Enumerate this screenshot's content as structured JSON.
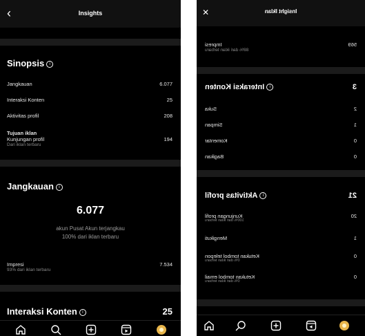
{
  "left": {
    "header": {
      "title": "Insights"
    },
    "sinopsis": {
      "title": "Sinopsis",
      "rows": [
        {
          "label": "Jangkauan",
          "value": "6.077"
        },
        {
          "label": "Interaksi Konten",
          "value": "25"
        },
        {
          "label": "Aktivitas profil",
          "value": "208"
        }
      ],
      "goal_title": "Tujuan iklan",
      "goal_label": "Kunjungan profil",
      "goal_sub": "Dari iklan terbaru",
      "goal_value": "194"
    },
    "jangkauan": {
      "title": "Jangkauan",
      "big_value": "6.077",
      "desc1": "akun Pusat Akun terjangkau",
      "desc2": "100% dari iklan terbaru",
      "impresi_label": "Impresi",
      "impresi_sub": "93% dari iklan terbaru",
      "impresi_value": "7.534"
    },
    "interaksi": {
      "title": "Interaksi Konten",
      "value": "25"
    }
  },
  "right": {
    "header": {
      "title": "Insight Iklan"
    },
    "impresi": {
      "label": "Impresi",
      "sub": "88% dari iklan terbaru",
      "value": "569"
    },
    "interaksi": {
      "title": "Interaksi Konten",
      "value": "3",
      "rows": [
        {
          "label": "Suka",
          "value": "2"
        },
        {
          "label": "Simpan",
          "value": "1"
        },
        {
          "label": "Komentar",
          "value": "0"
        },
        {
          "label": "Bagikan",
          "value": "0"
        }
      ]
    },
    "aktivitas": {
      "title": "Aktivitas profil",
      "value": "21",
      "rows": [
        {
          "label": "Kunjungan profil",
          "sub": "100% dari iklan terbaru",
          "value": "20"
        },
        {
          "label": "Mengikuti",
          "sub": "",
          "value": "1"
        },
        {
          "label": "Ketukan tombol telepon",
          "sub": "0% dari iklan terbaru",
          "value": "0"
        },
        {
          "label": "Ketukan tombol email",
          "sub": "0% dari iklan terbaru",
          "value": "0"
        }
      ]
    }
  }
}
